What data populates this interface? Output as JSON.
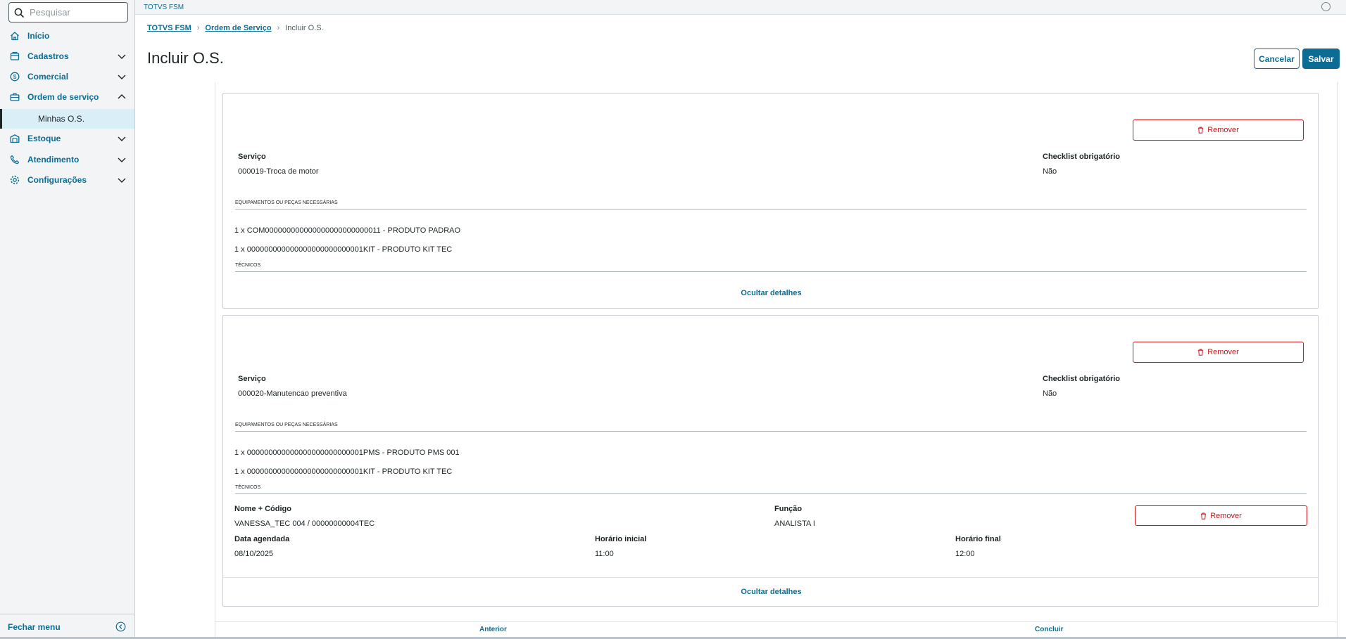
{
  "app": {
    "title": "TOTVS FSM"
  },
  "search": {
    "placeholder": "Pesquisar"
  },
  "sidebar": {
    "items": [
      {
        "label": "Início"
      },
      {
        "label": "Cadastros"
      },
      {
        "label": "Comercial"
      },
      {
        "label": "Ordem de serviço"
      },
      {
        "label": "Minhas O.S."
      },
      {
        "label": "Estoque"
      },
      {
        "label": "Atendimento"
      },
      {
        "label": "Configurações"
      }
    ],
    "close_label": "Fechar menu"
  },
  "breadcrumb": {
    "root": "TOTVS FSM",
    "parent": "Ordem de Serviço",
    "current": "Incluir O.S."
  },
  "page": {
    "title": "Incluir O.S.",
    "cancel_label": "Cancelar",
    "save_label": "Salvar"
  },
  "services": [
    {
      "remove_label": "Remover",
      "service_label": "Serviço",
      "service_value": "000019-Troca de motor",
      "checklist_label": "Checklist obrigatório",
      "checklist_value": "Não",
      "equipment_title": "Equipamentos ou peças necessárias",
      "equipment": [
        "1 x COM000000000000000000000000011 - PRODUTO PADRAO",
        "1 x 000000000000000000000000001KIT - PRODUTO KIT TEC"
      ],
      "technicians_title": "Técnicos",
      "toggle_label": "Ocultar detalhes"
    },
    {
      "remove_label": "Remover",
      "service_label": "Serviço",
      "service_value": "000020-Manutencao preventiva",
      "checklist_label": "Checklist obrigatório",
      "checklist_value": "Não",
      "equipment_title": "Equipamentos ou peças necessárias",
      "equipment": [
        "1 x 000000000000000000000000001PMS - PRODUTO PMS 001",
        "1 x 000000000000000000000000001KIT - PRODUTO KIT TEC"
      ],
      "technicians_title": "Técnicos",
      "technician": {
        "name_label": "Nome + Código",
        "name_value": "VANESSA_TEC 004 / 00000000004TEC",
        "role_label": "Função",
        "role_value": "ANALISTA I",
        "remove_label": "Remover",
        "date_label": "Data agendada",
        "date_value": "08/10/2025",
        "start_label": "Horário inicial",
        "start_value": "11:00",
        "end_label": "Horário final",
        "end_value": "12:00"
      },
      "toggle_label": "Ocultar detalhes"
    }
  ],
  "footer": {
    "prev_label": "Anterior",
    "finish_label": "Concluir"
  },
  "colors": {
    "primary": "#0c6c94",
    "danger": "#c4161c",
    "sidebar_bg": "#f2f4f5",
    "active_item_bg": "#daeef7"
  }
}
